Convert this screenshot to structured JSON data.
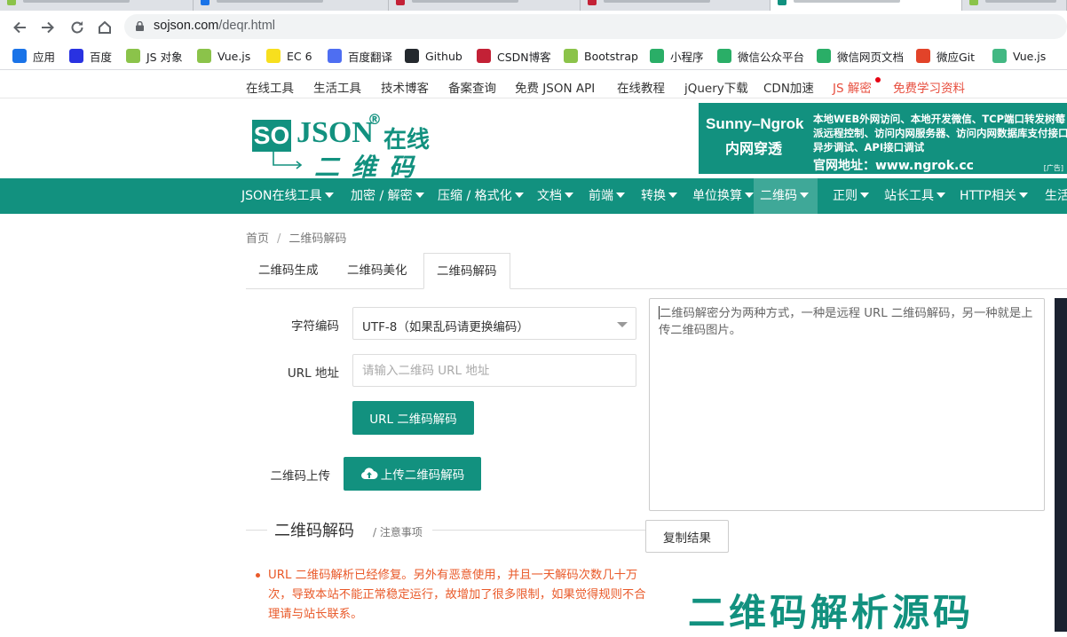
{
  "browser": {
    "url_host": "sojson.com",
    "url_path": "/deqr.html"
  },
  "bookmarks": [
    {
      "label": "应用",
      "icon": "apps-grid-icon",
      "color": "#1a73e8"
    },
    {
      "label": "百度",
      "icon": "baidu-paw-icon",
      "color": "#2932e1"
    },
    {
      "label": "JS 对象",
      "icon": "globe-icon",
      "color": "#8bc34a"
    },
    {
      "label": "Vue.js",
      "icon": "globe-icon",
      "color": "#8bc34a"
    },
    {
      "label": "EC 6",
      "icon": "es-logo-icon",
      "color": "#f7df1e"
    },
    {
      "label": "百度翻译",
      "icon": "translate-icon",
      "color": "#4e6ef2"
    },
    {
      "label": "Github",
      "icon": "github-icon",
      "color": "#24292e"
    },
    {
      "label": "CSDN博客",
      "icon": "csdn-icon",
      "color": "#c32136"
    },
    {
      "label": "Bootstrap",
      "icon": "globe-icon",
      "color": "#8bc34a"
    },
    {
      "label": "小程序",
      "icon": "wechat-icon",
      "color": "#2aae67"
    },
    {
      "label": "微信公众平台",
      "icon": "wechat-icon",
      "color": "#2aae67"
    },
    {
      "label": "微信网页文档",
      "icon": "wechat-icon",
      "color": "#2aae67"
    },
    {
      "label": "微应Git",
      "icon": "gitlab-icon",
      "color": "#e24329"
    },
    {
      "label": "Vue.js",
      "icon": "vue-icon",
      "color": "#42b883"
    }
  ],
  "toplinks": [
    {
      "label": "在线工具",
      "red": false
    },
    {
      "label": "生活工具",
      "red": false
    },
    {
      "label": "技术博客",
      "red": false
    },
    {
      "label": "备案查询",
      "red": false
    },
    {
      "label": "免费 JSON API",
      "red": false
    },
    {
      "label": "在线教程",
      "red": false
    },
    {
      "label": "jQuery下载",
      "red": false
    },
    {
      "label": "CDN加速",
      "red": false
    },
    {
      "label": "JS 解密",
      "red": true
    },
    {
      "label": "免费学习资料",
      "red": true
    }
  ],
  "logo": {
    "so": "SO",
    "json": "JSON",
    "reg": "®",
    "online": "在线",
    "sub": "二维码"
  },
  "ad": {
    "title": "Sunny–Ngrok",
    "subtitle": "内网穿透",
    "desc": "本地WEB外网访问、本地开发微信、TCP端口转发树莓派远程控制、访问内网服务器、访问内网数据库支付接口异步调试、API接口调试",
    "site": "官网地址：www.ngrok.cc",
    "tag": "[广告]"
  },
  "mainnav": [
    {
      "label": "JSON在线工具",
      "active": false
    },
    {
      "label": "加密 / 解密",
      "active": false
    },
    {
      "label": "压缩 / 格式化",
      "active": false
    },
    {
      "label": "文档",
      "active": false
    },
    {
      "label": "前端",
      "active": false
    },
    {
      "label": "转换",
      "active": false
    },
    {
      "label": "单位换算",
      "active": false
    },
    {
      "label": "二维码",
      "active": true
    },
    {
      "label": "正则",
      "active": false
    },
    {
      "label": "站长工具",
      "active": false
    },
    {
      "label": "HTTP相关",
      "active": false
    },
    {
      "label": "生活",
      "active": false
    }
  ],
  "breadcrumb": {
    "home": "首页",
    "sep": "/",
    "current": "二维码解码"
  },
  "tabs": [
    {
      "label": "二维码生成",
      "active": false
    },
    {
      "label": "二维码美化",
      "active": false
    },
    {
      "label": "二维码解码",
      "active": true
    }
  ],
  "form": {
    "charset_label": "字符编码",
    "charset_value": "UTF-8（如果乱码请更换编码）",
    "url_label": "URL 地址",
    "url_placeholder": "请输入二维码 URL 地址",
    "url_button": "URL 二维码解码",
    "upload_label": "二维码上传",
    "upload_button": "上传二维码解码"
  },
  "result": {
    "text": "二维码解密分为两种方式，一种是远程 URL 二维码解码，另一种就是上传二维码图片。",
    "copy_button": "复制结果"
  },
  "notes": {
    "title": "二维码解码",
    "subtitle": "/ 注意事项",
    "items": [
      "URL 二维码解析已经修复。另外有恶意使用，并且一天解码次数几十万次，导致本站不能正常稳定运行，故增加了很多限制，如果觉得规则不合理请与站长联系。"
    ]
  },
  "watermark": "二维码解析源码"
}
